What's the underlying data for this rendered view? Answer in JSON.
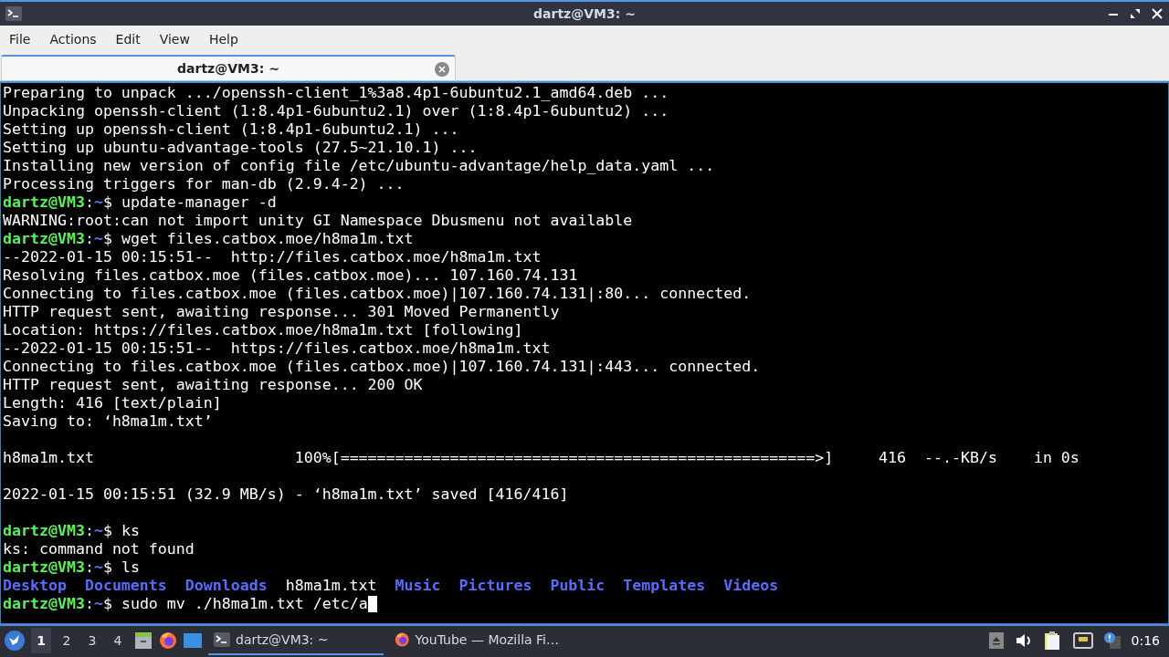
{
  "window": {
    "title": "dartz@VM3: ~"
  },
  "menu": [
    "File",
    "Actions",
    "Edit",
    "View",
    "Help"
  ],
  "tabs": [
    {
      "label": "dartz@VM3: ~",
      "selected": true
    }
  ],
  "terminal": {
    "lines": [
      {
        "kind": "output",
        "segments": [
          {
            "kind": "plain",
            "text": "Preparing to unpack .../openssh-client_1%3a8.4p1-6ubuntu2.1_amd64.deb ..."
          }
        ]
      },
      {
        "kind": "output",
        "segments": [
          {
            "kind": "plain",
            "text": "Unpacking openssh-client (1:8.4p1-6ubuntu2.1) over (1:8.4p1-6ubuntu2) ..."
          }
        ]
      },
      {
        "kind": "output",
        "segments": [
          {
            "kind": "plain",
            "text": "Setting up openssh-client (1:8.4p1-6ubuntu2.1) ..."
          }
        ]
      },
      {
        "kind": "output",
        "segments": [
          {
            "kind": "plain",
            "text": "Setting up ubuntu-advantage-tools (27.5~21.10.1) ..."
          }
        ]
      },
      {
        "kind": "output",
        "segments": [
          {
            "kind": "plain",
            "text": "Installing new version of config file /etc/ubuntu-advantage/help_data.yaml ..."
          }
        ]
      },
      {
        "kind": "output",
        "segments": [
          {
            "kind": "plain",
            "text": "Processing triggers for man-db (2.9.4-2) ..."
          }
        ]
      },
      {
        "kind": "output",
        "segments": [
          {
            "kind": "user",
            "text": "dartz@VM3"
          },
          {
            "kind": "plain",
            "text": ":"
          },
          {
            "kind": "path",
            "text": "~"
          },
          {
            "kind": "plain",
            "text": "$ update-manager -d"
          }
        ]
      },
      {
        "kind": "output",
        "segments": [
          {
            "kind": "plain",
            "text": "WARNING:root:can not import unity GI Namespace Dbusmenu not available"
          }
        ]
      },
      {
        "kind": "output",
        "segments": [
          {
            "kind": "user",
            "text": "dartz@VM3"
          },
          {
            "kind": "plain",
            "text": ":"
          },
          {
            "kind": "path",
            "text": "~"
          },
          {
            "kind": "plain",
            "text": "$ wget files.catbox.moe/h8ma1m.txt"
          }
        ]
      },
      {
        "kind": "output",
        "segments": [
          {
            "kind": "plain",
            "text": "--2022-01-15 00:15:51--  http://files.catbox.moe/h8ma1m.txt"
          }
        ]
      },
      {
        "kind": "output",
        "segments": [
          {
            "kind": "plain",
            "text": "Resolving files.catbox.moe (files.catbox.moe)... 107.160.74.131"
          }
        ]
      },
      {
        "kind": "output",
        "segments": [
          {
            "kind": "plain",
            "text": "Connecting to files.catbox.moe (files.catbox.moe)|107.160.74.131|:80... connected."
          }
        ]
      },
      {
        "kind": "output",
        "segments": [
          {
            "kind": "plain",
            "text": "HTTP request sent, awaiting response... 301 Moved Permanently"
          }
        ]
      },
      {
        "kind": "output",
        "segments": [
          {
            "kind": "plain",
            "text": "Location: https://files.catbox.moe/h8ma1m.txt [following]"
          }
        ]
      },
      {
        "kind": "output",
        "segments": [
          {
            "kind": "plain",
            "text": "--2022-01-15 00:15:51--  https://files.catbox.moe/h8ma1m.txt"
          }
        ]
      },
      {
        "kind": "output",
        "segments": [
          {
            "kind": "plain",
            "text": "Connecting to files.catbox.moe (files.catbox.moe)|107.160.74.131|:443... connected."
          }
        ]
      },
      {
        "kind": "output",
        "segments": [
          {
            "kind": "plain",
            "text": "HTTP request sent, awaiting response... 200 OK"
          }
        ]
      },
      {
        "kind": "output",
        "segments": [
          {
            "kind": "plain",
            "text": "Length: 416 [text/plain]"
          }
        ]
      },
      {
        "kind": "output",
        "segments": [
          {
            "kind": "plain",
            "text": "Saving to: ‘h8ma1m.txt’"
          }
        ]
      },
      {
        "kind": "blank"
      },
      {
        "kind": "output",
        "segments": [
          {
            "kind": "plain",
            "text": "h8ma1m.txt                      100%[====================================================>]     416  --.-KB/s    in 0s"
          }
        ]
      },
      {
        "kind": "blank"
      },
      {
        "kind": "output",
        "segments": [
          {
            "kind": "plain",
            "text": "2022-01-15 00:15:51 (32.9 MB/s) - ‘h8ma1m.txt’ saved [416/416]"
          }
        ]
      },
      {
        "kind": "blank"
      },
      {
        "kind": "output",
        "segments": [
          {
            "kind": "user",
            "text": "dartz@VM3"
          },
          {
            "kind": "plain",
            "text": ":"
          },
          {
            "kind": "path",
            "text": "~"
          },
          {
            "kind": "plain",
            "text": "$ ks"
          }
        ]
      },
      {
        "kind": "output",
        "segments": [
          {
            "kind": "plain",
            "text": "ks: command not found"
          }
        ]
      },
      {
        "kind": "output",
        "segments": [
          {
            "kind": "user",
            "text": "dartz@VM3"
          },
          {
            "kind": "plain",
            "text": ":"
          },
          {
            "kind": "path",
            "text": "~"
          },
          {
            "kind": "plain",
            "text": "$ ls"
          }
        ]
      },
      {
        "kind": "listing",
        "segments": [
          {
            "kind": "dir",
            "text": "Desktop"
          },
          {
            "kind": "dir",
            "text": "Documents"
          },
          {
            "kind": "dir",
            "text": "Downloads"
          },
          {
            "kind": "plain",
            "text": "h8ma1m.txt"
          },
          {
            "kind": "dir",
            "text": "Music"
          },
          {
            "kind": "dir",
            "text": "Pictures"
          },
          {
            "kind": "dir",
            "text": "Public"
          },
          {
            "kind": "dir",
            "text": "Templates"
          },
          {
            "kind": "dir",
            "text": "Videos"
          }
        ]
      },
      {
        "kind": "input",
        "segments": [
          {
            "kind": "user",
            "text": "dartz@VM3"
          },
          {
            "kind": "plain",
            "text": ":"
          },
          {
            "kind": "path",
            "text": "~"
          },
          {
            "kind": "plain",
            "text": "$ sudo mv ./h8ma1m.txt /etc/a"
          }
        ]
      }
    ]
  },
  "taskbar": {
    "workspaces": [
      {
        "label": "1",
        "selected": true
      },
      {
        "label": "2",
        "selected": false
      },
      {
        "label": "3",
        "selected": false
      },
      {
        "label": "4",
        "selected": false
      }
    ],
    "tasks": [
      {
        "kind": "terminal",
        "label": "dartz@VM3: ~",
        "selected": true
      },
      {
        "kind": "browser",
        "label": "YouTube — Mozilla Fi…",
        "selected": false
      }
    ],
    "clock": "0:16"
  }
}
